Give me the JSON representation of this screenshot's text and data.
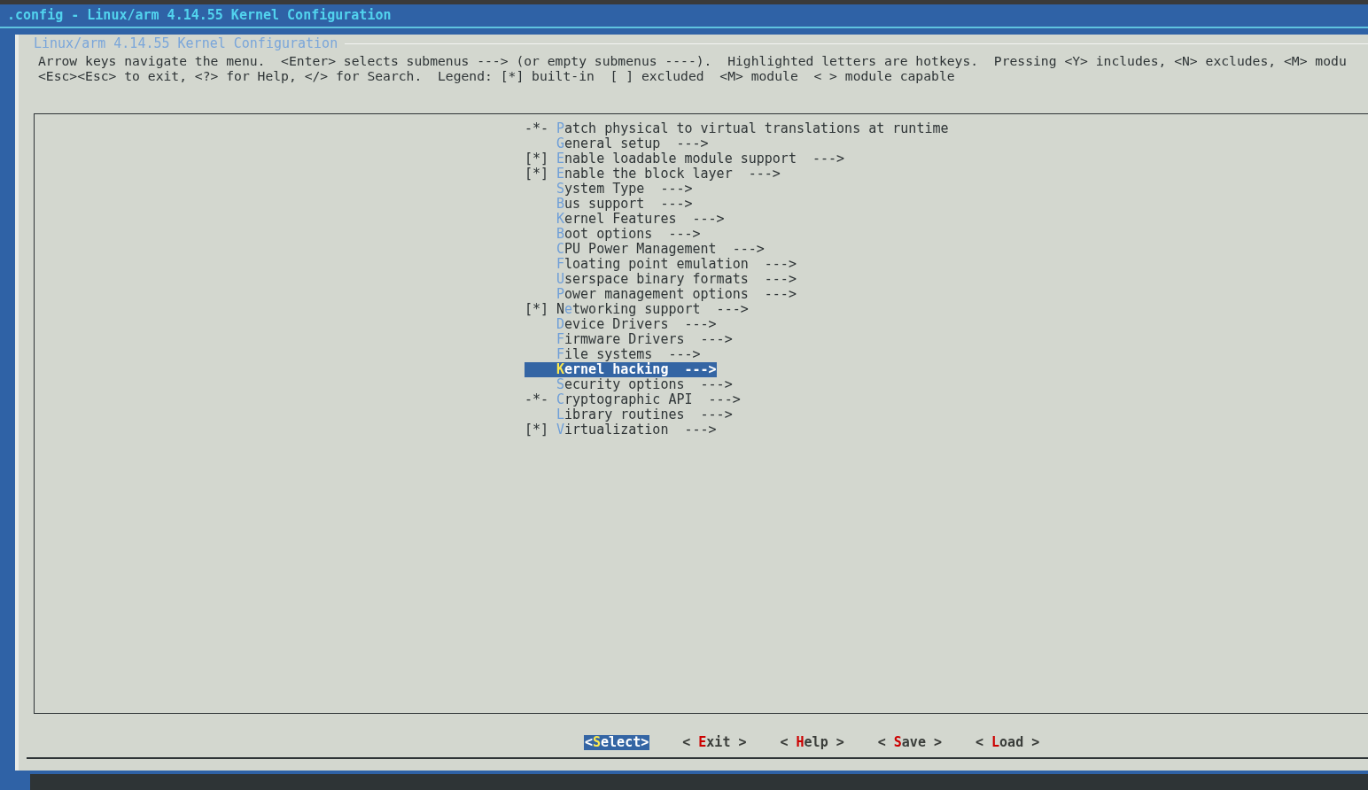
{
  "window": {
    "title": ".config - Linux/arm 4.14.55 Kernel Configuration"
  },
  "dialog": {
    "title": "Linux/arm 4.14.55 Kernel Configuration",
    "help_lines": [
      "Arrow keys navigate the menu.  <Enter> selects submenus ---> (or empty submenus ----).  Highlighted letters are hotkeys.  Pressing <Y> includes, <N> excludes, <M> modu",
      "<Esc><Esc> to exit, <?> for Help, </> for Search.  Legend: [*] built-in  [ ] excluded  <M> module  < > module capable"
    ]
  },
  "menu": [
    {
      "prefix": "-*-",
      "hotkey": "P",
      "after": "atch physical to virtual translations at runtime",
      "selected": false
    },
    {
      "hotkey": "G",
      "after": "eneral setup  --->",
      "selected": false
    },
    {
      "prefix": "[*]",
      "hotkey": "E",
      "after": "nable loadable module support  --->",
      "selected": false
    },
    {
      "prefix": "[*]",
      "hotkey": "E",
      "after": "nable the block layer  --->",
      "selected": false
    },
    {
      "hotkey": "S",
      "after": "ystem Type  --->",
      "selected": false
    },
    {
      "hotkey": "B",
      "after": "us support  --->",
      "selected": false
    },
    {
      "hotkey": "K",
      "after": "ernel Features  --->",
      "selected": false
    },
    {
      "hotkey": "B",
      "after": "oot options  --->",
      "selected": false
    },
    {
      "hotkey": "C",
      "after": "PU Power Management  --->",
      "selected": false
    },
    {
      "hotkey": "F",
      "after": "loating point emulation  --->",
      "selected": false
    },
    {
      "hotkey": "U",
      "after": "serspace binary formats  --->",
      "selected": false
    },
    {
      "hotkey": "P",
      "after": "ower management options  --->",
      "selected": false
    },
    {
      "prefix": "[*]",
      "before": "N",
      "hotkey": "e",
      "after": "tworking support  --->",
      "selected": false
    },
    {
      "hotkey": "D",
      "after": "evice Drivers  --->",
      "selected": false
    },
    {
      "hotkey": "F",
      "after": "irmware Drivers  --->",
      "selected": false
    },
    {
      "hotkey": "F",
      "after": "ile systems  --->",
      "selected": false
    },
    {
      "hotkey": "K",
      "after": "ernel hacking  --->",
      "selected": true
    },
    {
      "hotkey": "S",
      "after": "ecurity options  --->",
      "selected": false
    },
    {
      "prefix": "-*-",
      "hotkey": "C",
      "after": "ryptographic API  --->",
      "selected": false
    },
    {
      "hotkey": "L",
      "after": "ibrary routines  --->",
      "selected": false
    },
    {
      "prefix": "[*]",
      "hotkey": "V",
      "after": "irtualization  --->",
      "selected": false
    }
  ],
  "buttons": [
    {
      "open": "<",
      "hotkey": "S",
      "rest": "elect",
      "close": ">",
      "selected": true
    },
    {
      "open": "< ",
      "hotkey": "E",
      "rest": "xit",
      "close": " >",
      "selected": false
    },
    {
      "open": "< ",
      "hotkey": "H",
      "rest": "elp",
      "close": " >",
      "selected": false
    },
    {
      "open": "< ",
      "hotkey": "S",
      "rest": "ave",
      "close": " >",
      "selected": false
    },
    {
      "open": "< ",
      "hotkey": "L",
      "rest": "oad",
      "close": " >",
      "selected": false
    }
  ]
}
